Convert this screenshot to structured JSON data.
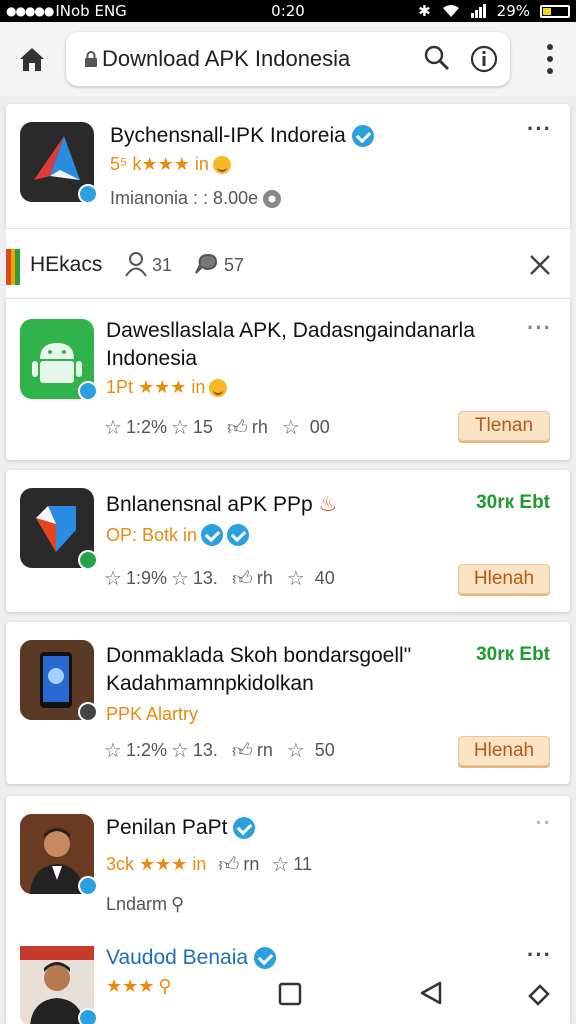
{
  "status": {
    "carrier": "INob ENG",
    "time": "0:20",
    "battery": "29%"
  },
  "toolbar": {
    "url": "Download APK Indonesia"
  },
  "header_card": {
    "title": "Bychensnall-IPK Indoreia",
    "rating": "5⁵ k★★★ in",
    "meta": "Imianonia : : 8.00e"
  },
  "tabs": {
    "label": "HEkacs",
    "users": "31",
    "comments": "57"
  },
  "items": [
    {
      "title": "Dawesllaslala APK, Dadasngaindanarla",
      "title2": "Indonesia",
      "sub": "1Pt ★★★ in",
      "s1": "1:2%",
      "s2": "15",
      "s3": "rh",
      "s4": "00",
      "button": "Tlenan"
    },
    {
      "title": "Bnlanensnal aPK PPp",
      "price": "30rк Ebt",
      "sub": "OP: Botk in",
      "s1": "1:9%",
      "s2": "13.",
      "s3": "rh",
      "s4": "40",
      "button": "Hlenah"
    },
    {
      "title": "Donmaklada Skoh bondarsgoell\"",
      "title2": "Kadahmamnpkidolkan",
      "price": "30rк Ebt",
      "sub": "PPK Alartry",
      "s1": "1:2%",
      "s2": "13.",
      "s3": "rn",
      "s4": "50",
      "button": "Hlenah"
    },
    {
      "title": "Penilan PaPt",
      "sub": "3ck ★★★ in",
      "s3": "rn",
      "s4": "11",
      "meta": "Lndarm"
    },
    {
      "title": "Vaudod Benaia",
      "sub": "★★★"
    }
  ],
  "colors": {
    "accent_blue": "#2aa0de",
    "accent_green": "#1f9a2f",
    "button_text": "#b55a12",
    "stars": "#e98b0d"
  }
}
